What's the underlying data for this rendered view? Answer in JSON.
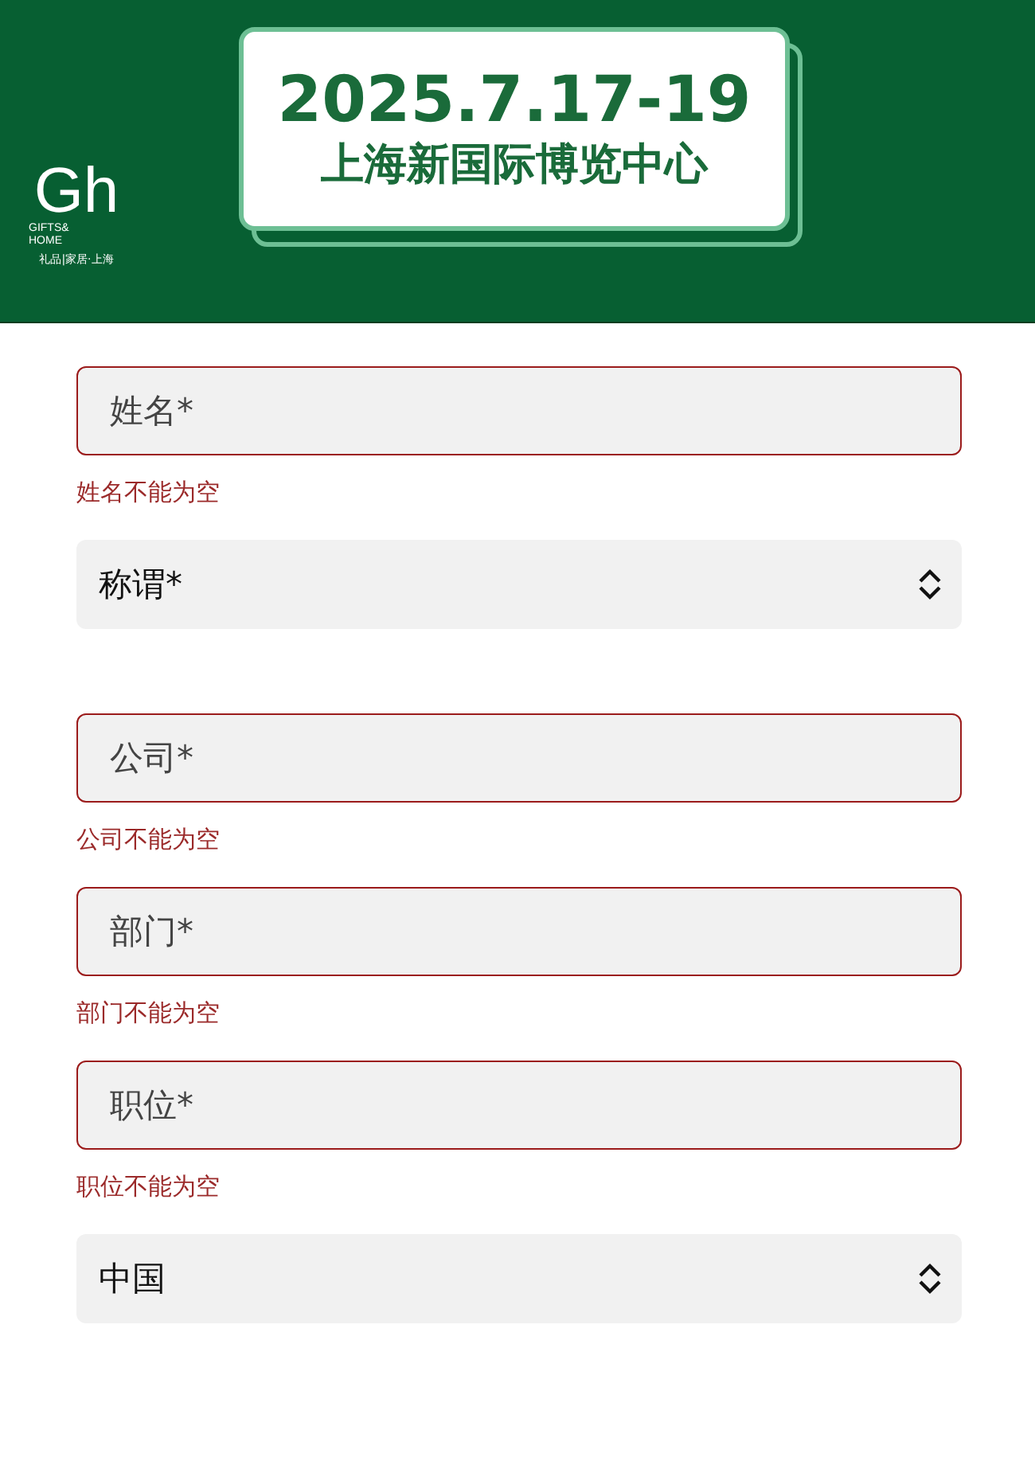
{
  "header": {
    "logo": {
      "mark": "Gh",
      "name_lines": [
        "GIFTS&",
        "HOME"
      ],
      "tagline": "礼品|家居·上海"
    },
    "date": "2025.7.17-19",
    "venue": "上海新国际博览中心"
  },
  "form": [
    {
      "kind": "input",
      "placeholder": "姓名*",
      "invalid": true,
      "error": "姓名不能为空"
    },
    {
      "kind": "select",
      "value": "称谓*"
    },
    {
      "kind": "input",
      "placeholder": "公司*",
      "invalid": true,
      "error": "公司不能为空"
    },
    {
      "kind": "input",
      "placeholder": "部门*",
      "invalid": true,
      "error": "部门不能为空"
    },
    {
      "kind": "input",
      "placeholder": "职位*",
      "invalid": true,
      "error": "职位不能为空"
    },
    {
      "kind": "select",
      "value": "中国"
    }
  ]
}
